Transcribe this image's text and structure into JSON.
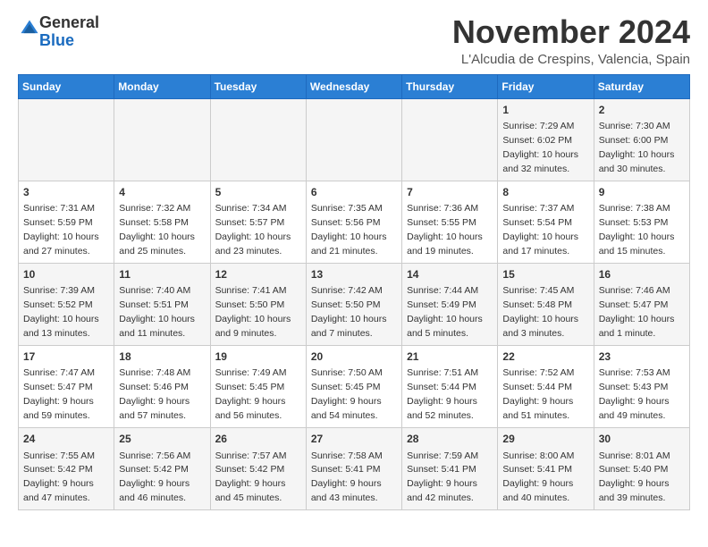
{
  "header": {
    "logo_general": "General",
    "logo_blue": "Blue",
    "month": "November 2024",
    "location": "L'Alcudia de Crespins, Valencia, Spain"
  },
  "weekdays": [
    "Sunday",
    "Monday",
    "Tuesday",
    "Wednesday",
    "Thursday",
    "Friday",
    "Saturday"
  ],
  "weeks": [
    [
      {
        "day": "",
        "info": ""
      },
      {
        "day": "",
        "info": ""
      },
      {
        "day": "",
        "info": ""
      },
      {
        "day": "",
        "info": ""
      },
      {
        "day": "",
        "info": ""
      },
      {
        "day": "1",
        "info": "Sunrise: 7:29 AM\nSunset: 6:02 PM\nDaylight: 10 hours and 32 minutes."
      },
      {
        "day": "2",
        "info": "Sunrise: 7:30 AM\nSunset: 6:00 PM\nDaylight: 10 hours and 30 minutes."
      }
    ],
    [
      {
        "day": "3",
        "info": "Sunrise: 7:31 AM\nSunset: 5:59 PM\nDaylight: 10 hours and 27 minutes."
      },
      {
        "day": "4",
        "info": "Sunrise: 7:32 AM\nSunset: 5:58 PM\nDaylight: 10 hours and 25 minutes."
      },
      {
        "day": "5",
        "info": "Sunrise: 7:34 AM\nSunset: 5:57 PM\nDaylight: 10 hours and 23 minutes."
      },
      {
        "day": "6",
        "info": "Sunrise: 7:35 AM\nSunset: 5:56 PM\nDaylight: 10 hours and 21 minutes."
      },
      {
        "day": "7",
        "info": "Sunrise: 7:36 AM\nSunset: 5:55 PM\nDaylight: 10 hours and 19 minutes."
      },
      {
        "day": "8",
        "info": "Sunrise: 7:37 AM\nSunset: 5:54 PM\nDaylight: 10 hours and 17 minutes."
      },
      {
        "day": "9",
        "info": "Sunrise: 7:38 AM\nSunset: 5:53 PM\nDaylight: 10 hours and 15 minutes."
      }
    ],
    [
      {
        "day": "10",
        "info": "Sunrise: 7:39 AM\nSunset: 5:52 PM\nDaylight: 10 hours and 13 minutes."
      },
      {
        "day": "11",
        "info": "Sunrise: 7:40 AM\nSunset: 5:51 PM\nDaylight: 10 hours and 11 minutes."
      },
      {
        "day": "12",
        "info": "Sunrise: 7:41 AM\nSunset: 5:50 PM\nDaylight: 10 hours and 9 minutes."
      },
      {
        "day": "13",
        "info": "Sunrise: 7:42 AM\nSunset: 5:50 PM\nDaylight: 10 hours and 7 minutes."
      },
      {
        "day": "14",
        "info": "Sunrise: 7:44 AM\nSunset: 5:49 PM\nDaylight: 10 hours and 5 minutes."
      },
      {
        "day": "15",
        "info": "Sunrise: 7:45 AM\nSunset: 5:48 PM\nDaylight: 10 hours and 3 minutes."
      },
      {
        "day": "16",
        "info": "Sunrise: 7:46 AM\nSunset: 5:47 PM\nDaylight: 10 hours and 1 minute."
      }
    ],
    [
      {
        "day": "17",
        "info": "Sunrise: 7:47 AM\nSunset: 5:47 PM\nDaylight: 9 hours and 59 minutes."
      },
      {
        "day": "18",
        "info": "Sunrise: 7:48 AM\nSunset: 5:46 PM\nDaylight: 9 hours and 57 minutes."
      },
      {
        "day": "19",
        "info": "Sunrise: 7:49 AM\nSunset: 5:45 PM\nDaylight: 9 hours and 56 minutes."
      },
      {
        "day": "20",
        "info": "Sunrise: 7:50 AM\nSunset: 5:45 PM\nDaylight: 9 hours and 54 minutes."
      },
      {
        "day": "21",
        "info": "Sunrise: 7:51 AM\nSunset: 5:44 PM\nDaylight: 9 hours and 52 minutes."
      },
      {
        "day": "22",
        "info": "Sunrise: 7:52 AM\nSunset: 5:44 PM\nDaylight: 9 hours and 51 minutes."
      },
      {
        "day": "23",
        "info": "Sunrise: 7:53 AM\nSunset: 5:43 PM\nDaylight: 9 hours and 49 minutes."
      }
    ],
    [
      {
        "day": "24",
        "info": "Sunrise: 7:55 AM\nSunset: 5:42 PM\nDaylight: 9 hours and 47 minutes."
      },
      {
        "day": "25",
        "info": "Sunrise: 7:56 AM\nSunset: 5:42 PM\nDaylight: 9 hours and 46 minutes."
      },
      {
        "day": "26",
        "info": "Sunrise: 7:57 AM\nSunset: 5:42 PM\nDaylight: 9 hours and 45 minutes."
      },
      {
        "day": "27",
        "info": "Sunrise: 7:58 AM\nSunset: 5:41 PM\nDaylight: 9 hours and 43 minutes."
      },
      {
        "day": "28",
        "info": "Sunrise: 7:59 AM\nSunset: 5:41 PM\nDaylight: 9 hours and 42 minutes."
      },
      {
        "day": "29",
        "info": "Sunrise: 8:00 AM\nSunset: 5:41 PM\nDaylight: 9 hours and 40 minutes."
      },
      {
        "day": "30",
        "info": "Sunrise: 8:01 AM\nSunset: 5:40 PM\nDaylight: 9 hours and 39 minutes."
      }
    ]
  ]
}
